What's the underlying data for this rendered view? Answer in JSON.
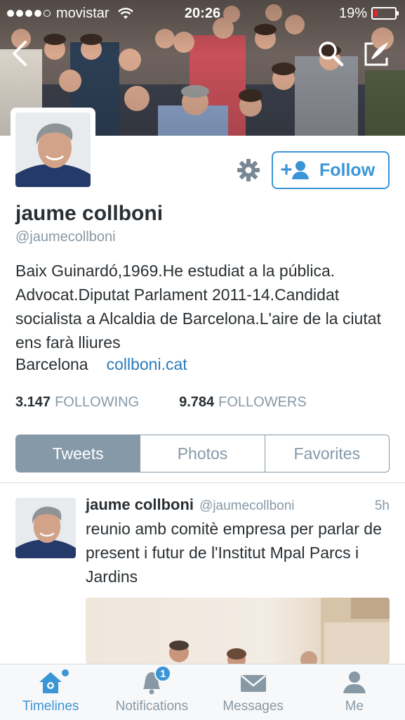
{
  "status_bar": {
    "carrier": "movistar",
    "time": "20:26",
    "battery": "19%",
    "battery_level": 0.19,
    "battery_color": "#e0262a"
  },
  "nav": {
    "back_icon": "chevron-left-icon",
    "search_icon": "search-icon",
    "compose_icon": "compose-icon"
  },
  "profile": {
    "name": "jaume collboni",
    "handle": "@jaumecollboni",
    "bio": "Baix Guinardó,1969.He estudiat a la pública. Advocat.Diputat Parlament 2011-14.Candidat socialista a Alcaldia de Barcelona.L'aire de la ciutat ens farà lliures",
    "location": "Barcelona",
    "website": "collboni.cat",
    "follow_label": "Follow",
    "following_count": "3.147",
    "following_label": "FOLLOWING",
    "followers_count": "9.784",
    "followers_label": "FOLLOWERS"
  },
  "segments": {
    "tweets": "Tweets",
    "photos": "Photos",
    "favorites": "Favorites",
    "active": "tweets"
  },
  "tweet": {
    "name": "jaume collboni",
    "handle": "@jaumecollboni",
    "time": "5h",
    "text": "reunio amb comitè empresa per parlar de present i futur de l'Institut Mpal Parcs i Jardins"
  },
  "tabbar": {
    "timelines": "Timelines",
    "notifications": "Notifications",
    "notifications_badge": "1",
    "messages": "Messages",
    "me": "Me",
    "active": "timelines"
  },
  "colors": {
    "accent": "#3a95d6",
    "segment": "#8699a8",
    "link": "#2b7bb9"
  }
}
